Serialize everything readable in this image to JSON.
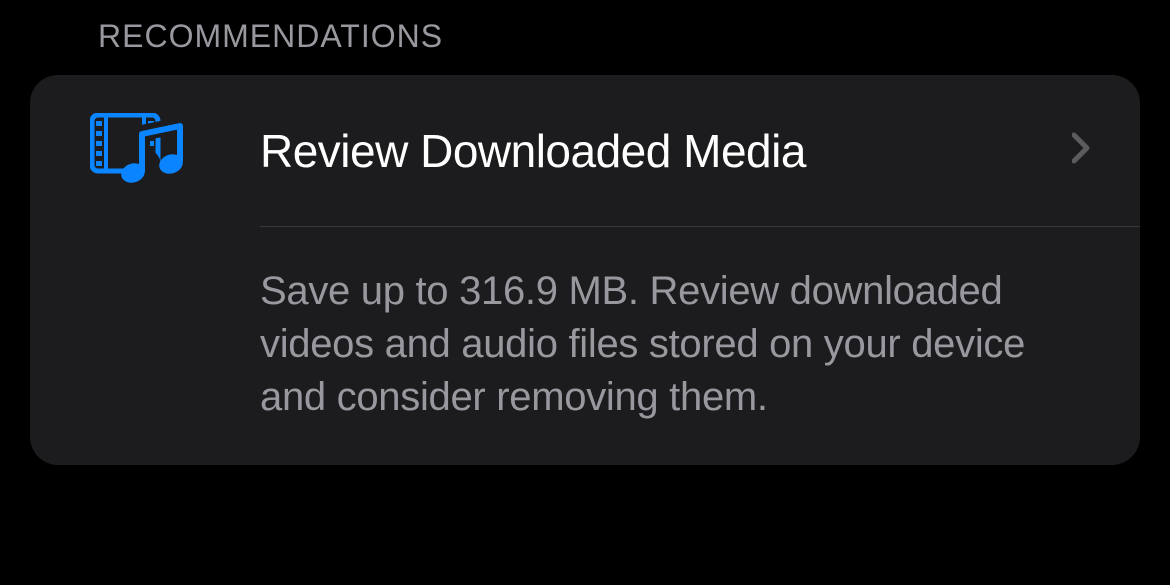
{
  "section": {
    "header": "RECOMMENDATIONS"
  },
  "recommendation": {
    "title": "Review Downloaded Media",
    "description": "Save up to 316.9 MB. Review downloaded videos and audio files stored on your device and consider removing them.",
    "icon_name": "media-video-music-icon"
  },
  "colors": {
    "accent": "#0A84FF",
    "background": "#000000",
    "card": "#1C1C1E",
    "text_primary": "#FFFFFF",
    "text_secondary": "#98989F"
  }
}
